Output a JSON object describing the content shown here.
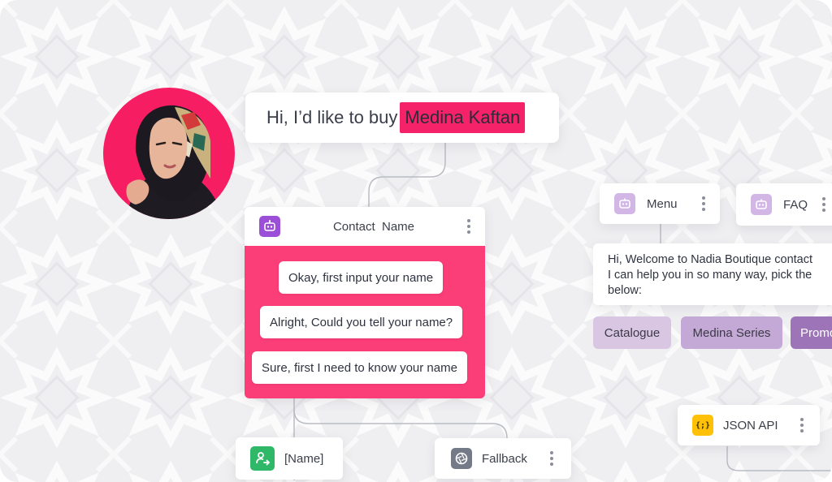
{
  "user_message": {
    "text": "Hi, I’d like to buy",
    "product": "Medina Kaftan"
  },
  "contact_name_block": {
    "title": "Contact  Name",
    "icon": "bot-icon",
    "responses": [
      "Okay, first input your name",
      "Alright, Could you tell your name?",
      "Sure, first I need to know your name"
    ]
  },
  "nodes": {
    "menu": {
      "label": "Menu",
      "icon": "bot-icon"
    },
    "faq": {
      "label": "FAQ",
      "icon": "bot-icon"
    },
    "json_api": {
      "label": "JSON API",
      "icon": "code-braces-icon",
      "icon_text": "{;}"
    },
    "name_var": {
      "label": "[Name]",
      "icon": "user-transfer-icon"
    },
    "fallback": {
      "label": "Fallback",
      "icon": "aperture-icon"
    }
  },
  "welcome_message": {
    "line1": "Hi, Welcome to Nadia Boutique contact",
    "line2": "I can help you in so many way, pick the",
    "line3": "below:"
  },
  "quick_replies": [
    "Catalogue",
    "Medina Series",
    "Promo"
  ],
  "colors": {
    "accent_pink": "#fb3d78",
    "highlight_pink": "#f5226a",
    "bot_purple": "#9b4fd8",
    "json_yellow": "#ffc107",
    "var_green": "#2eb867",
    "fallback_grey": "#747a88",
    "quick1": "#d8c6e3",
    "quick2": "#c4a9d6",
    "quick3": "#9d74b7"
  }
}
